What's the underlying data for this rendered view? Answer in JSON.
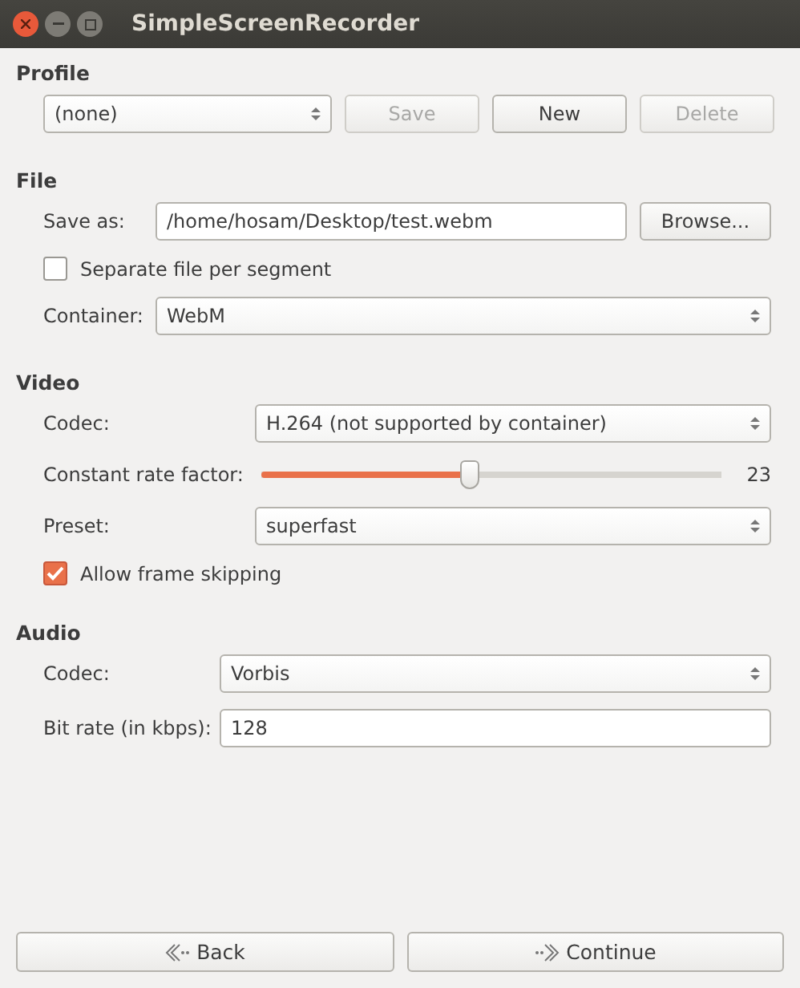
{
  "window": {
    "title": "SimpleScreenRecorder"
  },
  "profile": {
    "heading": "Profile",
    "combo": "(none)",
    "buttons": [
      {
        "label": "Save",
        "disabled": true
      },
      {
        "label": "New",
        "disabled": false
      },
      {
        "label": "Delete",
        "disabled": true
      }
    ]
  },
  "file": {
    "heading": "File",
    "save_as": {
      "label": "Save as:",
      "value": "/home/hosam/Desktop/test.webm",
      "button": "Browse..."
    },
    "separate": {
      "label": "Separate file per segment",
      "checked": false
    },
    "container": {
      "label": "Container:",
      "value": "WebM"
    }
  },
  "video": {
    "heading": "Video",
    "codec": {
      "label": "Codec:",
      "value": "H.264 (not supported by container)"
    },
    "crf": {
      "label": "Constant rate factor:",
      "level": 0.45,
      "reading": "23"
    },
    "preset": {
      "label": "Preset:",
      "value": "superfast"
    },
    "frame_skip": {
      "label": "Allow frame skipping",
      "checked": true
    }
  },
  "audio": {
    "heading": "Audio",
    "codec": {
      "label": "Codec:",
      "value": "Vorbis"
    },
    "bitrate": {
      "label": "Bit rate (in kbps):",
      "value": "128"
    }
  },
  "nav": {
    "back": "Back",
    "continue": "Continue"
  }
}
